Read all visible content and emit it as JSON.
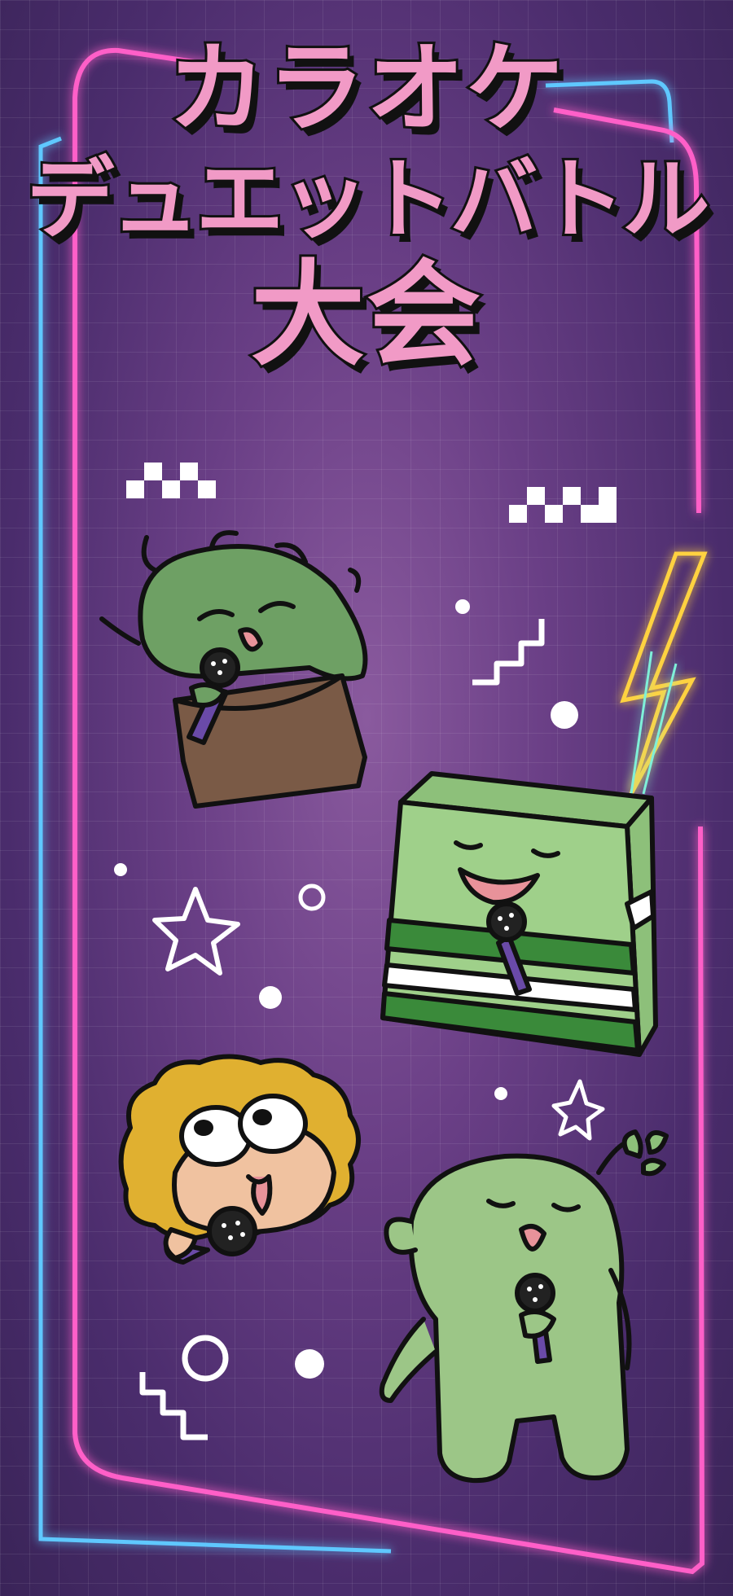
{
  "poster": {
    "title_line1": "カラオケ",
    "title_line2": "デュエットバトル",
    "title_line3": "大会"
  },
  "colors": {
    "neon_pink": "#ff5fc8",
    "neon_blue": "#5fc8ff",
    "neon_yellow": "#ffd23f",
    "title_pink": "#f19ac6",
    "character_green": "#6ea064",
    "character_light_green": "#9cc687",
    "hair_gold": "#e0b030"
  },
  "characters": [
    {
      "name": "cactus-in-pot-singer"
    },
    {
      "name": "striped-box-singer"
    },
    {
      "name": "curly-hair-singer"
    },
    {
      "name": "green-blob-singer"
    }
  ]
}
